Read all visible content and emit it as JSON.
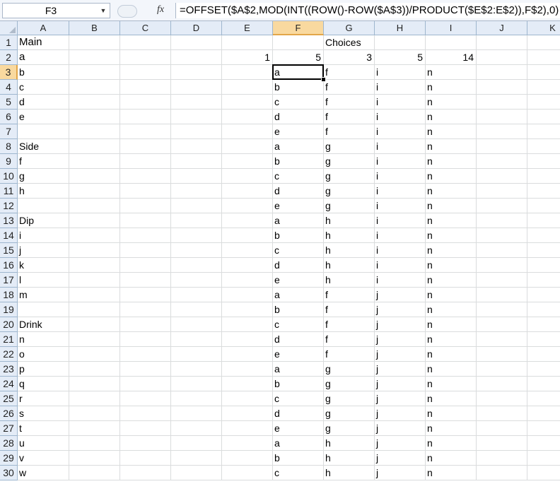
{
  "name_box": {
    "value": "F3",
    "dropdown_icon": "chevron-down-icon"
  },
  "formula_bar": {
    "fx_label": "fx",
    "formula": "=OFFSET($A$2,MOD(INT((ROW()-ROW($A$3))/PRODUCT($E$2:E$2)),F$2),0)"
  },
  "columns": [
    "A",
    "B",
    "C",
    "D",
    "E",
    "F",
    "G",
    "H",
    "I",
    "J",
    "K"
  ],
  "rows": [
    "1",
    "2",
    "3",
    "4",
    "5",
    "6",
    "7",
    "8",
    "9",
    "10",
    "11",
    "12",
    "13",
    "14",
    "15",
    "16",
    "17",
    "18",
    "19",
    "20",
    "21",
    "22",
    "23",
    "24",
    "25",
    "26",
    "27",
    "28",
    "29",
    "30"
  ],
  "active_cell": "F3",
  "col_A": [
    "Main",
    "a",
    "b",
    "c",
    "d",
    "e",
    "",
    "Side",
    "f",
    "g",
    "h",
    "",
    "Dip",
    "i",
    "j",
    "k",
    "l",
    "m",
    "",
    "Drink",
    "n",
    "o",
    "p",
    "q",
    "r",
    "s",
    "t",
    "u",
    "v",
    "w"
  ],
  "row1": {
    "G": "Choices"
  },
  "row2": {
    "E": "1",
    "F": "5",
    "G": "3",
    "H": "5",
    "I": "14"
  },
  "col_F": [
    "a",
    "b",
    "c",
    "d",
    "e",
    "a",
    "b",
    "c",
    "d",
    "e",
    "a",
    "b",
    "c",
    "d",
    "e",
    "a",
    "b",
    "c",
    "d",
    "e",
    "a",
    "b",
    "c",
    "d",
    "e",
    "a",
    "b",
    "c"
  ],
  "col_G": [
    "f",
    "f",
    "f",
    "f",
    "f",
    "g",
    "g",
    "g",
    "g",
    "g",
    "h",
    "h",
    "h",
    "h",
    "h",
    "f",
    "f",
    "f",
    "f",
    "f",
    "g",
    "g",
    "g",
    "g",
    "g",
    "h",
    "h",
    "h"
  ],
  "col_H": [
    "i",
    "i",
    "i",
    "i",
    "i",
    "i",
    "i",
    "i",
    "i",
    "i",
    "i",
    "i",
    "i",
    "i",
    "i",
    "j",
    "j",
    "j",
    "j",
    "j",
    "j",
    "j",
    "j",
    "j",
    "j",
    "j",
    "j",
    "j"
  ],
  "col_I": [
    "n",
    "n",
    "n",
    "n",
    "n",
    "n",
    "n",
    "n",
    "n",
    "n",
    "n",
    "n",
    "n",
    "n",
    "n",
    "n",
    "n",
    "n",
    "n",
    "n",
    "n",
    "n",
    "n",
    "n",
    "n",
    "n",
    "n",
    "n"
  ]
}
